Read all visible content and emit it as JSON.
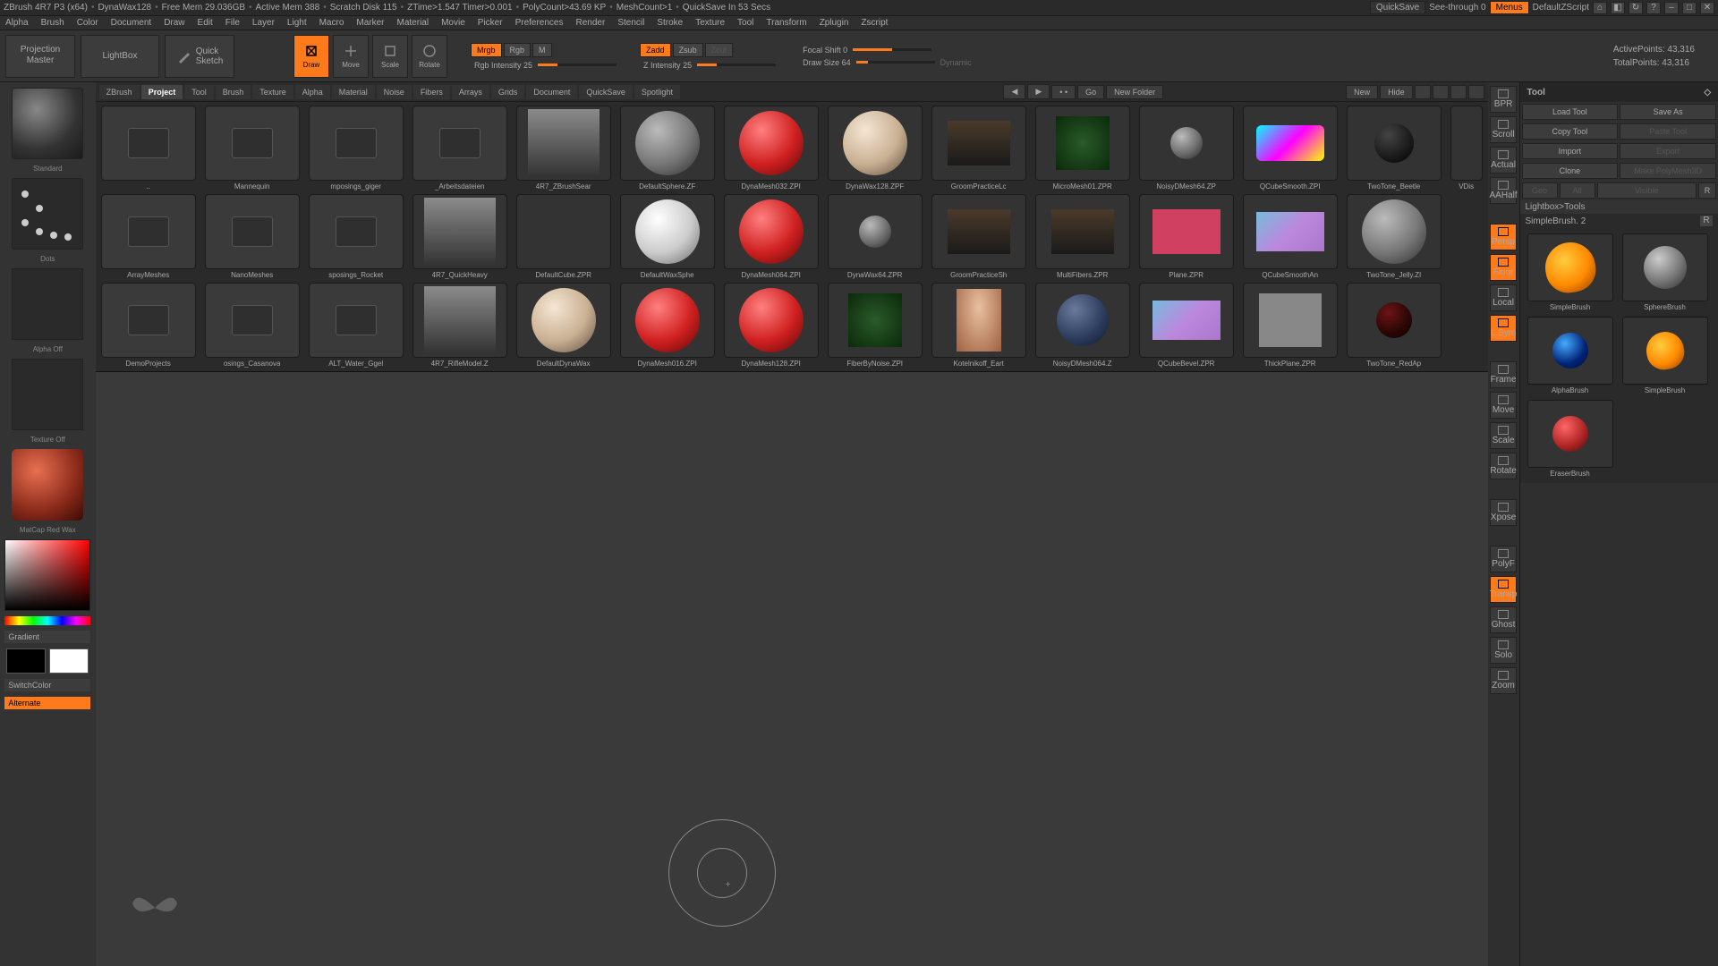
{
  "title": {
    "app": "ZBrush 4R7 P3 (x64)",
    "doc": "DynaWax128",
    "mem": "Free Mem 29.036GB",
    "amem": "Active Mem 388",
    "scratch": "Scratch Disk 115",
    "ztime": "ZTime>1.547 Timer>0.001",
    "poly": "PolyCount>43.69 KP",
    "mesh": "MeshCount>1",
    "qs": "QuickSave In 53 Secs",
    "quicksave": "QuickSave",
    "seethrough": "See-through  0",
    "menus": "Menus",
    "script": "DefaultZScript"
  },
  "menu": [
    "Alpha",
    "Brush",
    "Color",
    "Document",
    "Draw",
    "Edit",
    "File",
    "Layer",
    "Light",
    "Macro",
    "Marker",
    "Material",
    "Movie",
    "Picker",
    "Preferences",
    "Render",
    "Stencil",
    "Stroke",
    "Texture",
    "Tool",
    "Transform",
    "Zplugin",
    "Zscript"
  ],
  "shelf": {
    "pm1": "Projection",
    "pm2": "Master",
    "lightbox": "LightBox",
    "qs1": "Quick",
    "qs2": "Sketch",
    "draw": "Draw",
    "modes": [
      "Move",
      "Scale",
      "Rotate"
    ],
    "mrgb": "Mrgb",
    "rgb": "Rgb",
    "m": "M",
    "rgbi": "Rgb Intensity 25",
    "zadd": "Zadd",
    "zsub": "Zsub",
    "zcut": "Zcut",
    "zi": "Z Intensity 25",
    "focal": "Focal Shift 0",
    "drawsize": "Draw Size 64",
    "dynamic": "Dynamic",
    "ap": "ActivePoints: 43,316",
    "tp": "TotalPoints: 43,316"
  },
  "left": {
    "brush": "Standard",
    "dots": "Dots",
    "alpha": "Alpha Off",
    "mat": "MatCap Red Wax",
    "tex": "Texture Off",
    "grad": "Gradient",
    "switch": "SwitchColor",
    "alt": "Alternate"
  },
  "tabs": {
    "items": [
      "ZBrush",
      "Project",
      "Tool",
      "Brush",
      "Texture",
      "Alpha",
      "Material",
      "Noise",
      "Fibers",
      "Arrays",
      "Grids",
      "Document",
      "QuickSave",
      "Spotlight"
    ],
    "go": "Go",
    "new": "New",
    "hide": "Hide",
    "newf": "New Folder"
  },
  "grid": [
    [
      {
        "t": "folder",
        "n": ".."
      },
      {
        "t": "folder",
        "n": "Mannequin"
      },
      {
        "t": "folder",
        "n": "mposings_giger"
      },
      {
        "t": "folder",
        "n": "_Arbeitsdateien"
      },
      {
        "t": "mech",
        "n": "4R7_ZBrushSear"
      },
      {
        "t": "sphere-g",
        "n": "DefaultSphere.ZF"
      },
      {
        "t": "sphere-r",
        "n": "DynaMesh032.ZPI"
      },
      {
        "t": "sphere-t",
        "n": "DynaWax128.ZPF"
      },
      {
        "t": "dog",
        "n": "GroomPracticeLc"
      },
      {
        "t": "plant",
        "n": "MicroMesh01.ZPR"
      },
      {
        "t": "sphere-sm",
        "n": "NoisyDMesh64.ZP"
      },
      {
        "t": "box-grad",
        "n": "QCubeSmooth.ZPI"
      },
      {
        "t": "sphere-dk",
        "n": "TwoTone_Beetle"
      },
      {
        "t": "half",
        "n": "VDis"
      }
    ],
    [
      {
        "t": "folder",
        "n": "ArrayMeshes"
      },
      {
        "t": "folder",
        "n": "NanoMeshes"
      },
      {
        "t": "folder",
        "n": "sposings_Rocket"
      },
      {
        "t": "mech",
        "n": "4R7_QuickHeavy"
      },
      {
        "t": "blank",
        "n": "DefaultCube.ZPR"
      },
      {
        "t": "sphere-w",
        "n": "DefaultWaxSphe"
      },
      {
        "t": "sphere-r",
        "n": "DynaMesh064.ZPI"
      },
      {
        "t": "sphere-sm",
        "n": "DynaWax64.ZPR"
      },
      {
        "t": "dog",
        "n": "GroomPracticeSh"
      },
      {
        "t": "dog",
        "n": "MultiFibers.ZPR"
      },
      {
        "t": "box-pink",
        "n": "Plane.ZPR"
      },
      {
        "t": "box-cube",
        "n": "QCubeSmoothAn"
      },
      {
        "t": "sphere-g",
        "n": "TwoTone_Jelly.ZI"
      }
    ],
    [
      {
        "t": "folder",
        "n": "DemoProjects"
      },
      {
        "t": "folder",
        "n": "osings_Casanova"
      },
      {
        "t": "folder",
        "n": "ALT_Water_Ggel"
      },
      {
        "t": "mech",
        "n": "4R7_RifleModel.Z"
      },
      {
        "t": "sphere-t",
        "n": "DefaultDynaWax"
      },
      {
        "t": "sphere-r",
        "n": "DynaMesh016.ZPI"
      },
      {
        "t": "sphere-r",
        "n": "DynaMesh128.ZPI"
      },
      {
        "t": "plant",
        "n": "FiberByNoise.ZPI"
      },
      {
        "t": "char",
        "n": "Kotelnikoff_Eart"
      },
      {
        "t": "sphere-blu",
        "n": "NoisyDMesh064.Z"
      },
      {
        "t": "box-cube",
        "n": "QCubeBevel.ZPR"
      },
      {
        "t": "box-gray",
        "n": "ThickPlane.ZPR"
      },
      {
        "t": "sphere-dr",
        "n": "TwoTone_RedAp"
      }
    ]
  ],
  "rstrip": [
    {
      "n": "bpr",
      "l": "BPR"
    },
    {
      "n": "scroll",
      "l": "Scroll"
    },
    {
      "n": "actual",
      "l": "Actual"
    },
    {
      "n": "aahalf",
      "l": "AAHalf"
    },
    {
      "n": "persp",
      "l": "Persp",
      "on": true
    },
    {
      "n": "floor",
      "l": "Floor",
      "on": true
    },
    {
      "n": "local",
      "l": "Local"
    },
    {
      "n": "lsym",
      "l": "L.Sym",
      "on": true
    },
    {
      "n": "frame",
      "l": "Frame"
    },
    {
      "n": "move",
      "l": "Move"
    },
    {
      "n": "scale",
      "l": "Scale"
    },
    {
      "n": "rotate",
      "l": "Rotate"
    },
    {
      "n": "xpose",
      "l": "Xpose"
    },
    {
      "n": "pf",
      "l": "PolyF"
    },
    {
      "n": "transp",
      "l": "Transp",
      "on": true
    },
    {
      "n": "ghost",
      "l": "Ghost"
    },
    {
      "n": "solo",
      "l": "Solo"
    },
    {
      "n": "zoom",
      "l": "Zoom"
    }
  ],
  "right": {
    "title": "Tool",
    "load": "Load Tool",
    "save": "Save As",
    "copy": "Copy Tool",
    "paste": "Paste Tool",
    "import": "Import",
    "export": "Export",
    "clone": "Clone",
    "make": "Make PolyMesh3D",
    "hdr": "Lightbox>Tools",
    "cur": "SimpleBrush. 2",
    "r": "R",
    "geo": "Geo",
    "all": "All",
    "vis": "Visible",
    "tools": [
      {
        "t": "s-gold",
        "n": "SimpleBrush"
      },
      {
        "t": "s-gray",
        "n": "SphereBrush"
      },
      {
        "t": "s-blue",
        "n": "AlphaBrush"
      },
      {
        "t": "s-gold2",
        "n": "SimpleBrush"
      },
      {
        "t": "s-red",
        "n": "EraserBrush"
      }
    ]
  }
}
